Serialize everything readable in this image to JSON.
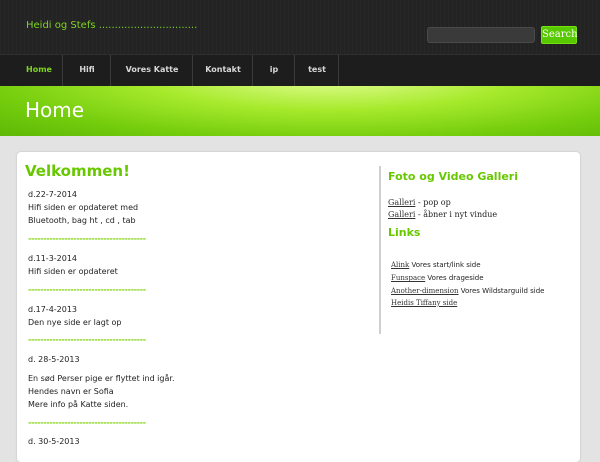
{
  "header": {
    "site_title": "Heidi og Stefs ...............................",
    "search_button": "Search"
  },
  "nav": {
    "items": [
      "Home",
      "Hifi",
      "Vores Katte",
      "Kontakt",
      "ip",
      "test"
    ]
  },
  "banner": {
    "title": "Home"
  },
  "main": {
    "welcome": "Velkommen!",
    "lines": [
      "d.22-7-2014",
      "Hifi siden er opdateret med",
      "Bluetooth, bag ht , cd , tab",
      "d.11-3-2014",
      "Hifi siden er opdateret",
      "d.17-4-2013",
      "Den nye side er lagt op",
      "d. 28-5-2013",
      "En sød Perser pige er flyttet ind igår.",
      "Hendes navn er Sofia",
      "Mere info på Katte siden.",
      "d. 30-5-2013"
    ],
    "divider": "---------------------------------------"
  },
  "sidebar": {
    "gallery_heading": "Foto og Video Galleri",
    "gallery_items": [
      {
        "link": "Galleri",
        "text": " - pop op"
      },
      {
        "link": "Galleri",
        "text": " - åbner i nyt vindue"
      }
    ],
    "links_heading": "Links",
    "links": [
      {
        "link": "Alink",
        "text": "  Vores start/link side"
      },
      {
        "link": "Funspace",
        "text": "  Vores drageside"
      },
      {
        "link": "Another-dimension",
        "text": "  Vores Wildstarguild side"
      },
      {
        "link": "Heidis Tiffany side",
        "text": ""
      }
    ]
  }
}
